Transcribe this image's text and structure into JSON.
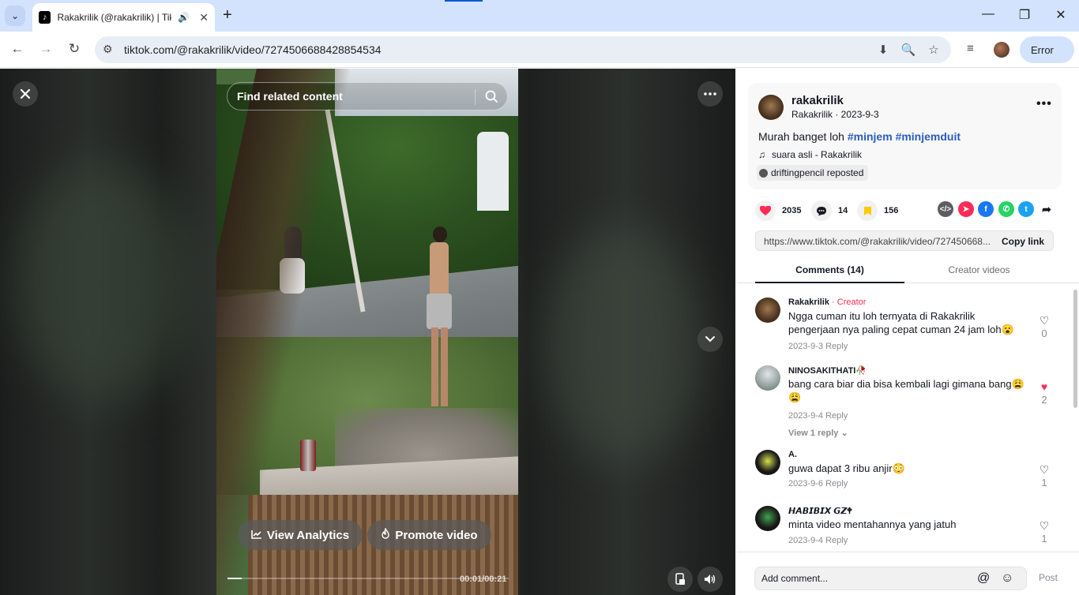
{
  "browser": {
    "tab_title": "Rakakrilik (@rakakrilik) | Tik",
    "url": "tiktok.com/@rakakrilik/video/7274506688428854534",
    "profile_button": "Error"
  },
  "video": {
    "search_placeholder": "Find related content",
    "view_analytics": "View Analytics",
    "promote_video": "Promote video",
    "time": "00:01/00:21",
    "progress_fraction": 0.05
  },
  "post": {
    "author_name": "rakakrilik",
    "author_sub": "Rakakrilik · 2023-9-3",
    "caption_text": "Murah banget loh ",
    "hashtag1": "#minjem",
    "hashtag2": "#minjemduit",
    "music": "suara asli - Rakakrilik",
    "repost": "driftingpencil reposted",
    "likes": "2035",
    "comments": "14",
    "saves": "156",
    "link": "https://www.tiktok.com/@rakakrilik/video/727450668...",
    "copy_link": "Copy link"
  },
  "tabs": {
    "comments": "Comments (14)",
    "creator_videos": "Creator videos"
  },
  "comments": [
    {
      "name": "Rakakrilik",
      "badge": " · Creator",
      "text": "Ngga cuman itu loh ternyata di Rakakrilik pengerjaan nya paling cepat cuman 24 jam loh😮",
      "meta": "2023-9-3  Reply",
      "likes": "0"
    },
    {
      "name": "NINOSAKITHATI🥀",
      "text": "bang cara biar dia bisa kembali lagi gimana bang😩😩",
      "meta": "2023-9-4  Reply",
      "likes": "2",
      "replies": "View 1 reply ⌄"
    },
    {
      "name": "A.",
      "text": "guwa dapat 3 ribu anjir😳",
      "meta": "2023-9-6  Reply",
      "likes": "1"
    },
    {
      "name": "𝙃𝘼𝘽𝙄𝘽𝙄𝙓 𝙂𝙕🕈",
      "text": "minta video mentahannya yang jatuh",
      "meta": "2023-9-4  Reply",
      "likes": "1"
    }
  ],
  "compose": {
    "placeholder": "Add comment...",
    "post": "Post"
  },
  "colors": {
    "hashtag": "#2b5db9",
    "creator_badge": "#fe2c55",
    "like_active": "#fe2c55"
  }
}
